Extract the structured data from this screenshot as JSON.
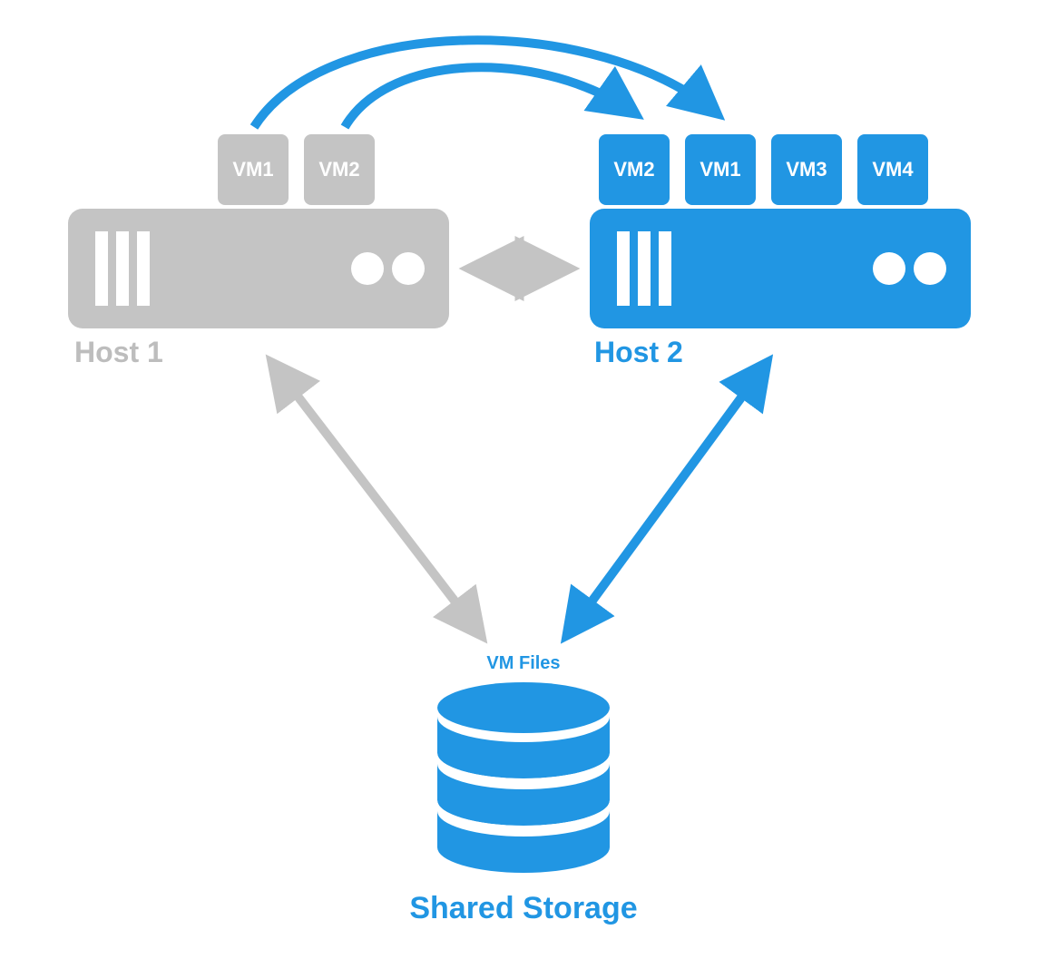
{
  "colors": {
    "grey": "#c4c4c4",
    "grey_light": "#bdbdbd",
    "blue": "#2196e3",
    "white": "#ffffff"
  },
  "host1": {
    "label": "Host 1",
    "vms": [
      {
        "label": "VM1"
      },
      {
        "label": "VM2"
      }
    ]
  },
  "host2": {
    "label": "Host 2",
    "vms": [
      {
        "label": "VM2"
      },
      {
        "label": "VM1"
      },
      {
        "label": "VM3"
      },
      {
        "label": "VM4"
      }
    ]
  },
  "storage": {
    "files_label": "VM Files",
    "label": "Shared Storage"
  },
  "arrows": {
    "migration": [
      {
        "from": "host1-vm1",
        "to": "host2-vm1"
      },
      {
        "from": "host1-vm2",
        "to": "host2-vm2"
      }
    ],
    "interconnect": "host1-host2",
    "storage_links": [
      {
        "host": "host1",
        "color": "grey"
      },
      {
        "host": "host2",
        "color": "blue"
      }
    ]
  }
}
